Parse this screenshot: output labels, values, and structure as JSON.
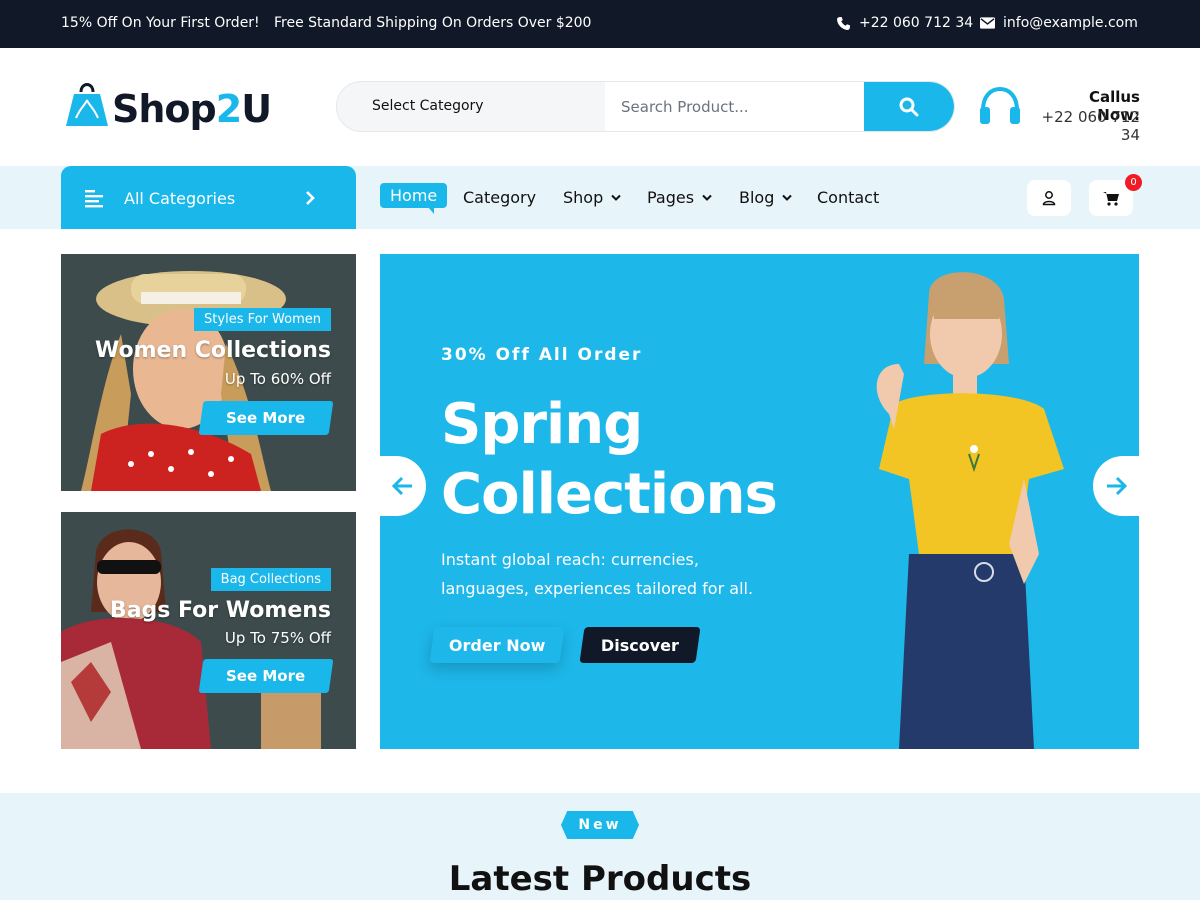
{
  "topbar": {
    "promo_first_order": "15% Off On Your First Order!",
    "promo_shipping": "Free Standard Shipping On Orders Over $200",
    "phone": "+22 060 712 34",
    "email": "info@example.com",
    "icons": [
      "phone-icon",
      "envelope-icon"
    ]
  },
  "header": {
    "logo_main": "Shop",
    "logo_accent": "2",
    "logo_end": "U",
    "search": {
      "category_label": "Select Category",
      "placeholder": "Search Product...",
      "button_icon": "search-icon"
    },
    "callus": {
      "label": "Callus Now:",
      "number": "+22 060 712 34"
    }
  },
  "nav": {
    "all_categories": "All Categories",
    "items": [
      {
        "label": "Home",
        "active": true
      },
      {
        "label": "Category"
      },
      {
        "label": "Shop",
        "dropdown": true
      },
      {
        "label": "Pages",
        "dropdown": true
      },
      {
        "label": "Blog",
        "dropdown": true
      },
      {
        "label": "Contact"
      }
    ],
    "cart_count": "0"
  },
  "banners": [
    {
      "tag": "Styles For Women",
      "title": "Women Collections",
      "subtitle": "Up To 60% Off",
      "button": "See More"
    },
    {
      "tag": "Bag Collections",
      "title": "Bags For Womens",
      "subtitle": "Up To 75% Off",
      "button": "See More"
    }
  ],
  "hero": {
    "offer": "30% Off All Order",
    "headline_line1": "Spring",
    "headline_line2": "Collections",
    "description": "Instant global reach: currencies, languages, experiences tailored for all.",
    "button_primary": "Order Now",
    "button_secondary": "Discover"
  },
  "latest": {
    "tag": "New",
    "title": "Latest Products"
  },
  "colors": {
    "accent": "#1ab7ea",
    "dark": "#111827",
    "light_band": "#e7f5fb",
    "badge": "#ef1c25"
  }
}
